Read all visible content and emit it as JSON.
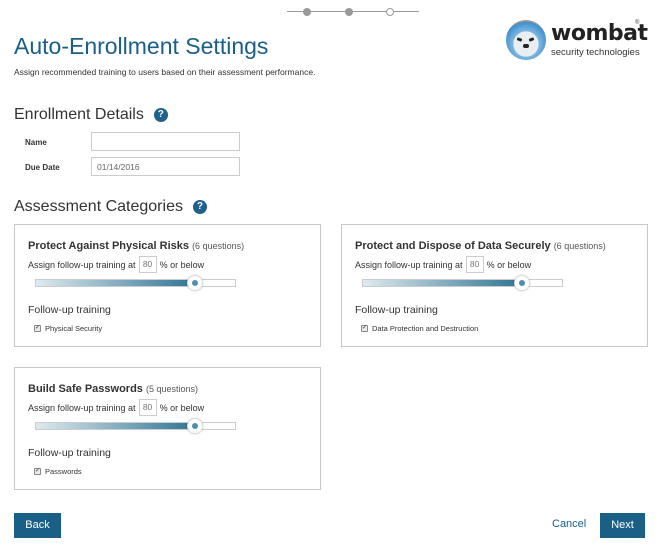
{
  "stepper": {
    "steps": 3,
    "current_step": 3
  },
  "logo": {
    "name": "wombat",
    "registered": "®",
    "tagline": "security technologies"
  },
  "header": {
    "title": "Auto-Enrollment Settings",
    "subtitle": "Assign recommended training to users based on their assessment performance."
  },
  "enrollment": {
    "title": "Enrollment Details",
    "help_icon": "?",
    "name_label": "Name",
    "name_value": "",
    "due_date_label": "Due Date",
    "due_date_value": "01/14/2016"
  },
  "categories": {
    "title": "Assessment Categories",
    "help_icon": "?",
    "assign_prefix": "Assign follow-up training at",
    "assign_suffix": "% or below",
    "followup_label": "Follow-up training",
    "checkmark": "✓",
    "items": [
      {
        "title": "Protect Against Physical Risks",
        "questions": "(6 questions)",
        "threshold": "80",
        "slider_percent": 80,
        "training": "Physical Security",
        "checked": true
      },
      {
        "title": "Protect and Dispose of Data Securely",
        "questions": "(6 questions)",
        "threshold": "80",
        "slider_percent": 80,
        "training": "Data Protection and Destruction",
        "checked": true
      },
      {
        "title": "Build Safe Passwords",
        "questions": "(5 questions)",
        "threshold": "80",
        "slider_percent": 80,
        "training": "Passwords",
        "checked": true
      }
    ]
  },
  "footer": {
    "back_label": "Back",
    "cancel_label": "Cancel",
    "next_label": "Next"
  },
  "colors": {
    "accent": "#1a5f86",
    "slider_fill_end": "#2e7493"
  }
}
